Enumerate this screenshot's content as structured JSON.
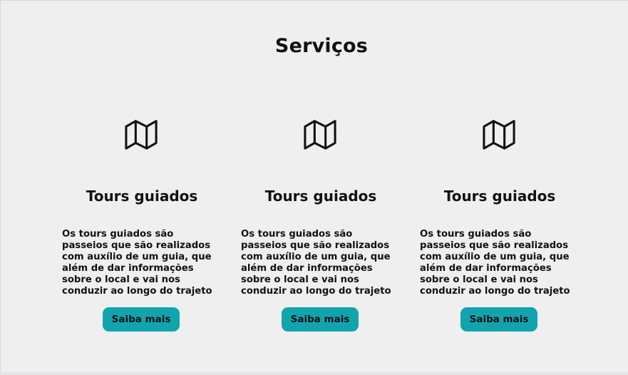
{
  "section": {
    "title": "Serviços"
  },
  "cards": [
    {
      "icon": "map-icon",
      "title": "Tours guiados",
      "text": "Os tours guiados são\npasseios que são realizados\ncom auxílio de um guia, que\nalém de dar informações\nsobre o local e vai nos\nconduzir ao longo do trajeto",
      "button_label": "Saiba mais"
    },
    {
      "icon": "map-icon",
      "title": "Tours guiados",
      "text": "Os tours guiados são\npasseios que são realizados\ncom auxílio de um guia, que\nalém de dar informações\nsobre o local e vai nos\nconduzir ao longo do trajeto",
      "button_label": "Saiba mais"
    },
    {
      "icon": "map-icon",
      "title": "Tours guiados",
      "text": "Os tours guiados são\npasseios que são realizados\ncom auxílio de um guia, que\nalém de dar informações\nsobre o local e vai nos\nconduzir ao longo do trajeto",
      "button_label": "Saiba mais"
    }
  ],
  "colors": {
    "background": "#efeff0",
    "button": "#12a4ae",
    "text": "#111111"
  }
}
